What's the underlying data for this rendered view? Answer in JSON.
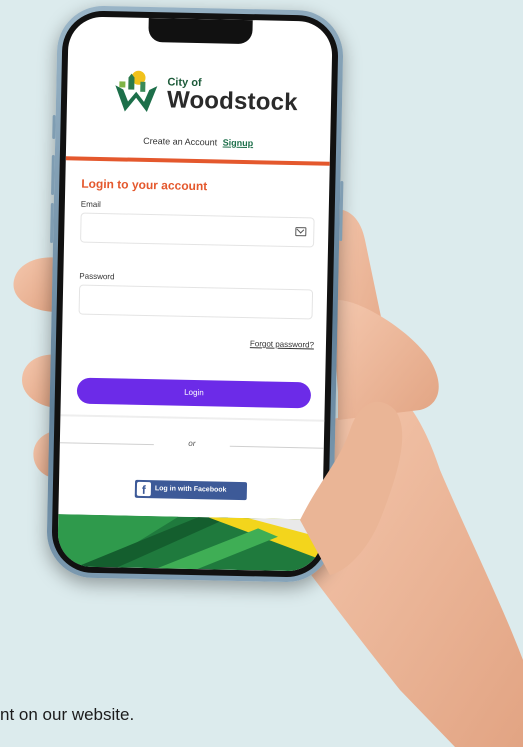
{
  "brand": {
    "small": "City of",
    "large": "Woodstock"
  },
  "create_account": {
    "text": "Create an Account",
    "signup_link": "Signup"
  },
  "login": {
    "title": "Login to your account",
    "email_label": "Email",
    "email_value": "",
    "password_label": "Password",
    "password_value": "",
    "forgot_link": "Forgot password?",
    "submit_label": "Login",
    "or_text": "or",
    "facebook_label": "Log in with Facebook"
  },
  "caption": {
    "text": "nt on our website."
  },
  "colors": {
    "accent_orange": "#e4582d",
    "primary_purple": "#6c2be8",
    "facebook_blue": "#3d5a98",
    "brand_green": "#1d6f4a",
    "background": "#dcebed"
  },
  "icons": {
    "logo": "city-of-woodstock-logo-icon",
    "email": "envelope-icon",
    "facebook": "facebook-f-icon"
  }
}
